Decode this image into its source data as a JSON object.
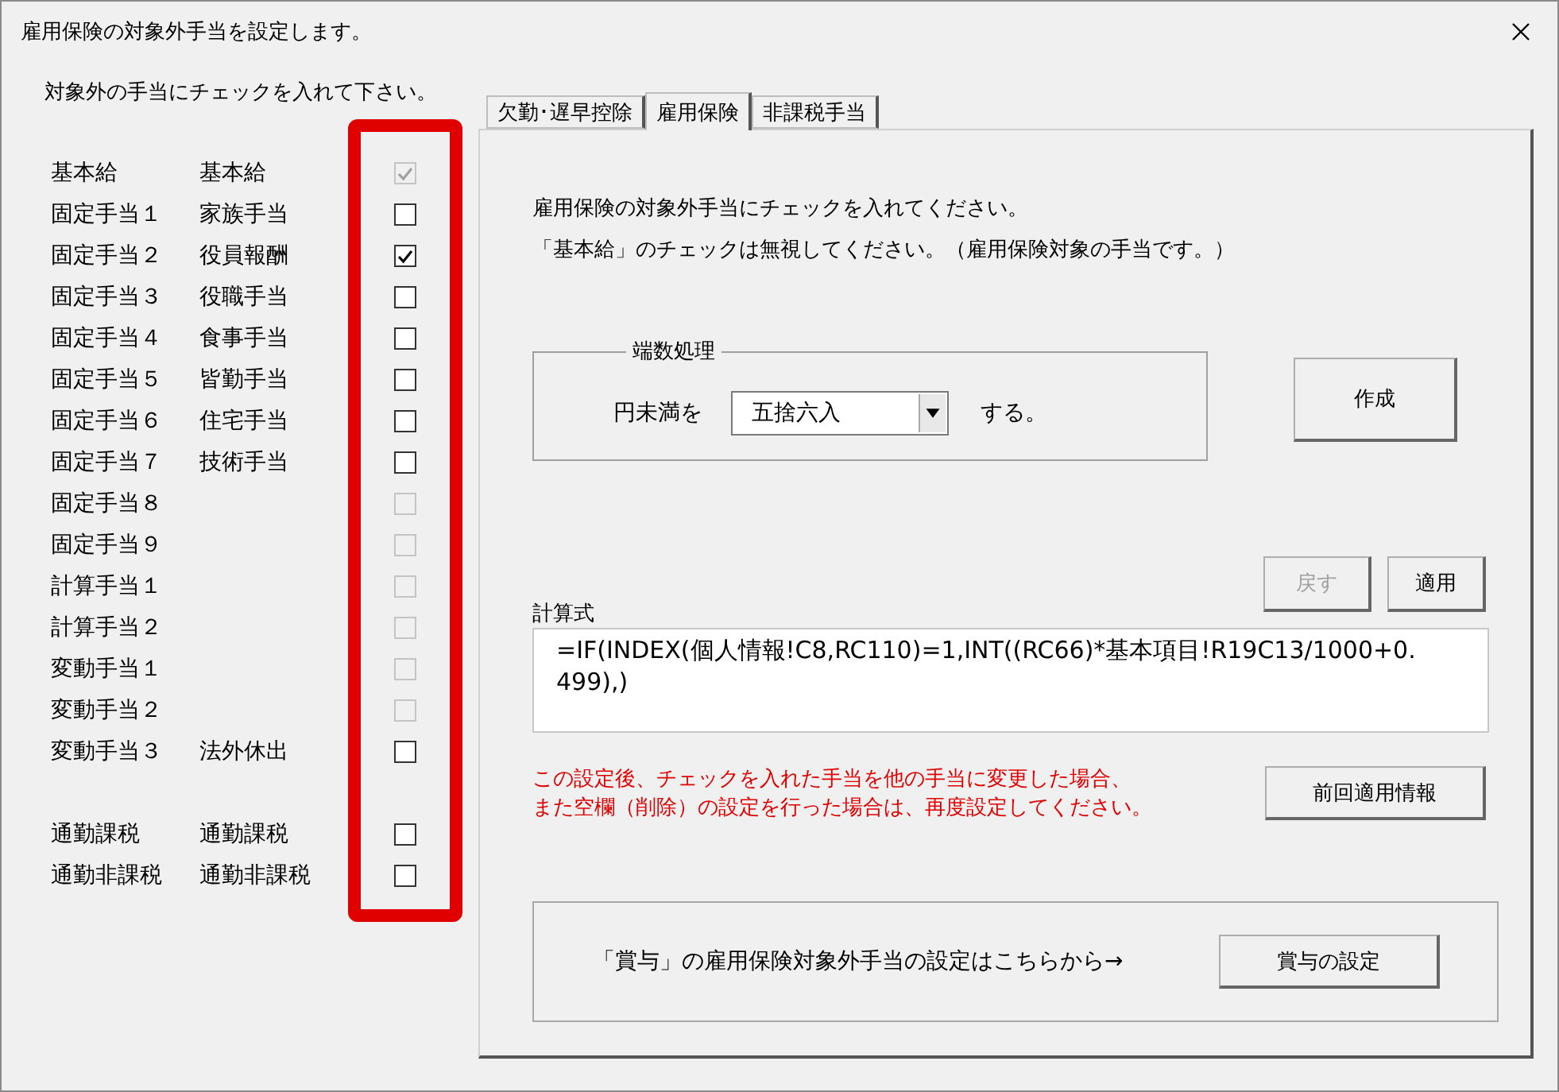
{
  "window": {
    "title": "雇用保険の対象外手当を設定します。"
  },
  "left": {
    "instruction": "対象外の手当にチェックを入れて下さい。",
    "groups": [
      [
        {
          "slot": "基本給",
          "name": "基本給",
          "checked": true,
          "disabled": true
        },
        {
          "slot": "固定手当１",
          "name": "家族手当",
          "checked": false,
          "disabled": false
        },
        {
          "slot": "固定手当２",
          "name": "役員報酬",
          "checked": true,
          "disabled": false
        },
        {
          "slot": "固定手当３",
          "name": "役職手当",
          "checked": false,
          "disabled": false
        },
        {
          "slot": "固定手当４",
          "name": "食事手当",
          "checked": false,
          "disabled": false
        },
        {
          "slot": "固定手当５",
          "name": "皆勤手当",
          "checked": false,
          "disabled": false
        },
        {
          "slot": "固定手当６",
          "name": "住宅手当",
          "checked": false,
          "disabled": false
        },
        {
          "slot": "固定手当７",
          "name": "技術手当",
          "checked": false,
          "disabled": false
        },
        {
          "slot": "固定手当８",
          "checked": false,
          "disabled": true
        },
        {
          "slot": "固定手当９",
          "checked": false,
          "disabled": true
        },
        {
          "slot": "計算手当１",
          "checked": false,
          "disabled": true
        },
        {
          "slot": "計算手当２",
          "checked": false,
          "disabled": true
        },
        {
          "slot": "変動手当１",
          "checked": false,
          "disabled": true
        },
        {
          "slot": "変動手当２",
          "checked": false,
          "disabled": true
        },
        {
          "slot": "変動手当３",
          "name": "法外休出",
          "checked": false,
          "disabled": false
        }
      ],
      [
        {
          "slot": "通勤課税",
          "name": "通勤課税",
          "checked": false,
          "disabled": false
        },
        {
          "slot": "通勤非課税",
          "name": "通勤非課税",
          "checked": false,
          "disabled": false
        }
      ]
    ]
  },
  "tabs": [
    {
      "label": "欠勤･遅早控除",
      "selected": false
    },
    {
      "label": "雇用保険",
      "selected": true
    },
    {
      "label": "非課税手当",
      "selected": false
    }
  ],
  "panel": {
    "description": [
      "雇用保険の対象外手当にチェックを入れてください。",
      "「基本給」のチェックは無視してください。（雇用保険対象の手当です。）"
    ],
    "rounding": {
      "legend": "端数処理",
      "prefix": "円未満を",
      "value": "五捨六入",
      "suffix": "する。"
    },
    "create_button": "作成",
    "revert_button": {
      "label": "戻す",
      "disabled": true
    },
    "apply_button": {
      "label": "適用",
      "disabled": false
    },
    "formula": {
      "label": "計算式",
      "value": "=IF(INDEX(個人情報!C8,RC110)=1,INT((RC66)*基本項目!R19C13/1000+0.499),)"
    },
    "warning": [
      "この設定後、チェックを入れた手当を他の手当に変更した場合、",
      "また空欄（削除）の設定を行った場合は、再度設定してください。"
    ],
    "previous_button": "前回適用情報",
    "bonus": {
      "text": "「賞与」の雇用保険対象外手当の設定はこちらから→",
      "button": "賞与の設定"
    }
  }
}
